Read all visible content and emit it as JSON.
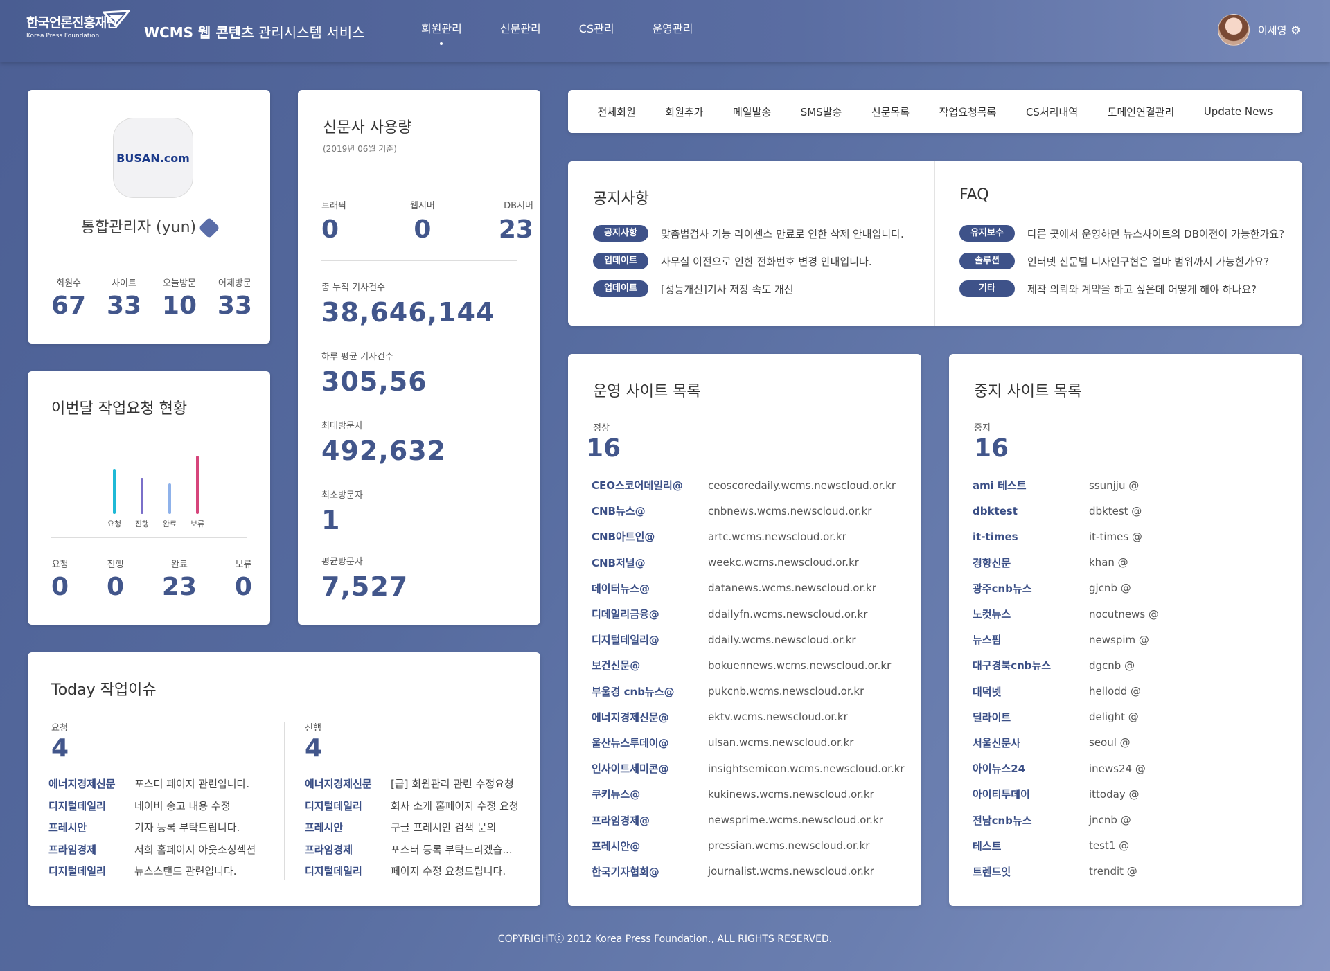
{
  "header": {
    "logo_ko": "한국언론진흥재단",
    "logo_en": "Korea Press Foundation",
    "title_bold": "WCMS 웹 콘텐츠",
    "title_rest": " 관리시스템 서비스",
    "nav": [
      "회원관리",
      "신문관리",
      "CS관리",
      "운영관리"
    ],
    "user_name": "이세영"
  },
  "profile": {
    "logo_text": "BUSAN.com",
    "name": "통합관리자 (yun)",
    "stats": [
      {
        "label": "회원수",
        "value": "67"
      },
      {
        "label": "사이트",
        "value": "33"
      },
      {
        "label": "오늘방문",
        "value": "10"
      },
      {
        "label": "어제방문",
        "value": "33"
      }
    ]
  },
  "job_status": {
    "title": "이번달 작업요청 현황",
    "chart_labels": [
      "요청",
      "진행",
      "완료",
      "보류"
    ],
    "stats": [
      {
        "label": "요청",
        "value": "0"
      },
      {
        "label": "진행",
        "value": "0"
      },
      {
        "label": "완료",
        "value": "23"
      },
      {
        "label": "보류",
        "value": "0"
      }
    ]
  },
  "chart_data": {
    "type": "bar",
    "categories": [
      "요청",
      "진행",
      "완료",
      "보류"
    ],
    "values": [
      62,
      50,
      42,
      80
    ],
    "colors": [
      "#1fb9d6",
      "#7a6fc9",
      "#8fb2ea",
      "#d6457b"
    ]
  },
  "usage": {
    "title": "신문사 사용량",
    "subtitle": "(2019년 06월 기준)",
    "top": [
      {
        "label": "트래픽",
        "value": "0"
      },
      {
        "label": "웹서버",
        "value": "0"
      },
      {
        "label": "DB서버",
        "value": "23"
      }
    ],
    "blocks": [
      {
        "label": "총 누적 기사건수",
        "value": "38,646,144"
      },
      {
        "label": "하루 평균 기사건수",
        "value": "305,56"
      },
      {
        "label": "최대방문자",
        "value": "492,632"
      },
      {
        "label": "최소방문자",
        "value": "1"
      },
      {
        "label": "평균방문자",
        "value": "7,527"
      }
    ]
  },
  "subnav": [
    "전체회원",
    "회원추가",
    "메일발송",
    "SMS발송",
    "신문목록",
    "작업요청목록",
    "CS처리내역",
    "도메인연결관리",
    "Update News"
  ],
  "notice": {
    "title": "공지사항",
    "items": [
      {
        "tag": "공지사항",
        "text": "맞춤법검사 기능 라이센스 만료로 인한 삭제 안내입니다."
      },
      {
        "tag": "업데이트",
        "text": "사무실 이전으로 인한 전화번호 변경 안내입니다."
      },
      {
        "tag": "업데이트",
        "text": "[성능개선]기사 저장 속도 개선"
      }
    ]
  },
  "faq": {
    "title": "FAQ",
    "items": [
      {
        "tag": "유지보수",
        "text": "다른 곳에서 운영하던 뉴스사이트의 DB이전이 가능한가요?"
      },
      {
        "tag": "솔루션",
        "text": "인터넷 신문별 디자인구현은 얼마 범위까지 가능한가요?"
      },
      {
        "tag": "기타",
        "text": "제작 의뢰와 계약을 하고 싶은데 어떻게 해야 하나요?"
      }
    ]
  },
  "active_sites": {
    "title": "운영 사이트 목록",
    "label": "정상",
    "count": "16",
    "rows": [
      [
        "CEO스코어데일리@",
        "ceoscoredaily.wcms.newscloud.or.kr"
      ],
      [
        "CNB뉴스@",
        "cnbnews.wcms.newscloud.or.kr"
      ],
      [
        "CNB아트인@",
        "artc.wcms.newscloud.or.kr"
      ],
      [
        "CNB저널@",
        "weekc.wcms.newscloud.or.kr"
      ],
      [
        "데이터뉴스@",
        "datanews.wcms.newscloud.or.kr"
      ],
      [
        "디데일리금융@",
        "ddailyfn.wcms.newscloud.or.kr"
      ],
      [
        "디지털데일리@",
        "ddaily.wcms.newscloud.or.kr"
      ],
      [
        "보건신문@",
        "bokuennews.wcms.newscloud.or.kr"
      ],
      [
        "부울경 cnb뉴스@",
        "pukcnb.wcms.newscloud.or.kr"
      ],
      [
        "에너지경제신문@",
        "ektv.wcms.newscloud.or.kr"
      ],
      [
        "울산뉴스투데이@",
        "ulsan.wcms.newscloud.or.kr"
      ],
      [
        "인사이트세미콘@",
        "insightsemicon.wcms.newscloud.or.kr"
      ],
      [
        "쿠키뉴스@",
        "kukinews.wcms.newscloud.or.kr"
      ],
      [
        "프라임경제@",
        "newsprime.wcms.newscloud.or.kr"
      ],
      [
        "프레시안@",
        "pressian.wcms.newscloud.or.kr"
      ],
      [
        "한국기자협회@",
        "journalist.wcms.newscloud.or.kr"
      ]
    ]
  },
  "stopped_sites": {
    "title": "중지 사이트 목록",
    "label": "중지",
    "count": "16",
    "rows": [
      [
        "ami 테스트",
        "ssunjju @"
      ],
      [
        "dbktest",
        "dbktest @"
      ],
      [
        "it-times",
        "it-times @"
      ],
      [
        "경향신문",
        "khan @"
      ],
      [
        "광주cnb뉴스",
        "gjcnb @"
      ],
      [
        "노컷뉴스",
        "nocutnews @"
      ],
      [
        "뉴스핌",
        "newspim @"
      ],
      [
        "대구경북cnb뉴스",
        "dgcnb @"
      ],
      [
        "대덕넷",
        "hellodd @"
      ],
      [
        "딜라이트",
        "delight @"
      ],
      [
        "서울신문사",
        "seoul @"
      ],
      [
        "아이뉴스24",
        "inews24 @"
      ],
      [
        "아이티투데이",
        "ittoday @"
      ],
      [
        "전남cnb뉴스",
        "jncnb @"
      ],
      [
        "테스트",
        "test1 @"
      ],
      [
        "트렌드잇",
        "trendit @"
      ]
    ]
  },
  "today": {
    "title": "Today 작업이슈",
    "request": {
      "label": "요청",
      "count": "4",
      "rows": [
        [
          "에너지경제신문",
          "포스터 페이지 관련입니다."
        ],
        [
          "디지털데일리",
          "네이버 송고 내용 수정"
        ],
        [
          "프레시안",
          "기자 등록 부탁드립니다."
        ],
        [
          "프라임경제",
          "저희 홈페이지 아웃소싱섹션"
        ],
        [
          "디지털데일리",
          "뉴스스탠드 관련입니다."
        ]
      ]
    },
    "progress": {
      "label": "진행",
      "count": "4",
      "rows": [
        [
          "에너지경제신문",
          "[급] 회원관리 관련 수정요청"
        ],
        [
          "디지털데일리",
          "회사 소개 홈페이지 수정 요청"
        ],
        [
          "프레시안",
          "구글 프레시안 검색 문의"
        ],
        [
          "프라임경제",
          "포스터 등록 부탁드리겠습..."
        ],
        [
          "디지털데일리",
          "페이지 수정 요청드립니다."
        ]
      ]
    }
  },
  "footer": "COPYRIGHTⓒ 2012 Korea Press Foundation., ALL RIGHTS RESERVED."
}
